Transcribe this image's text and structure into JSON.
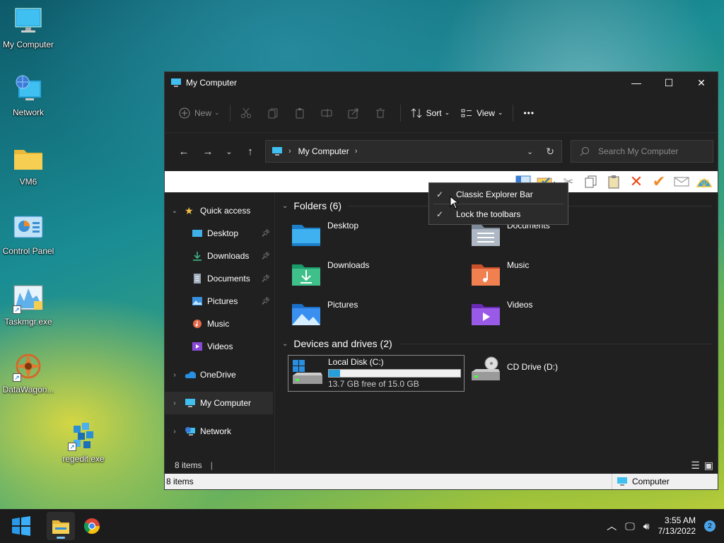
{
  "desktop": {
    "icons": [
      {
        "label": "My Computer",
        "icon": "monitor-icon"
      },
      {
        "label": "Network",
        "icon": "network-globe-icon"
      },
      {
        "label": "VM6",
        "icon": "folder-icon"
      },
      {
        "label": "Control Panel",
        "icon": "control-panel-icon"
      },
      {
        "label": "Taskmgr.exe",
        "icon": "task-manager-icon"
      },
      {
        "label": "DataWagon...",
        "icon": "datawagon-icon"
      },
      {
        "label": "regedit.exe",
        "icon": "regedit-icon"
      }
    ]
  },
  "window": {
    "title": "My Computer",
    "controls": {
      "minimize": "—",
      "maximize": "☐",
      "close": "✕"
    },
    "command_bar": {
      "new_label": "New",
      "sort_label": "Sort",
      "view_label": "View",
      "more_label": "•••"
    },
    "address": {
      "crumb": "My Computer",
      "search_placeholder": "Search My Computer"
    },
    "sidebar": {
      "quick_access": "Quick access",
      "items": [
        {
          "label": "Desktop",
          "pinned": true
        },
        {
          "label": "Downloads",
          "pinned": true
        },
        {
          "label": "Documents",
          "pinned": true
        },
        {
          "label": "Pictures",
          "pinned": true
        },
        {
          "label": "Music",
          "pinned": false
        },
        {
          "label": "Videos",
          "pinned": false
        }
      ],
      "onedrive": "OneDrive",
      "my_computer": "My Computer",
      "network": "Network"
    },
    "content": {
      "folders_header": "Folders (6)",
      "folders": [
        "Desktop",
        "Documents",
        "Downloads",
        "Music",
        "Pictures",
        "Videos"
      ],
      "devices_header": "Devices and drives (2)",
      "local_disk": {
        "name": "Local Disk (C:)",
        "free_text": "13.7 GB free of 15.0 GB",
        "used_fraction": 0.087
      },
      "cd_drive": {
        "name": "CD Drive (D:)"
      }
    },
    "status": {
      "items": "8 items"
    },
    "classic_status": {
      "items": "8 items",
      "location": "Computer"
    }
  },
  "context_menu": {
    "items": [
      {
        "label": "Classic Explorer Bar",
        "checked": true
      },
      {
        "label": "Lock the toolbars",
        "checked": true
      }
    ]
  },
  "taskbar": {
    "time": "3:55 AM",
    "date": "7/13/2022",
    "notifications": "2"
  }
}
